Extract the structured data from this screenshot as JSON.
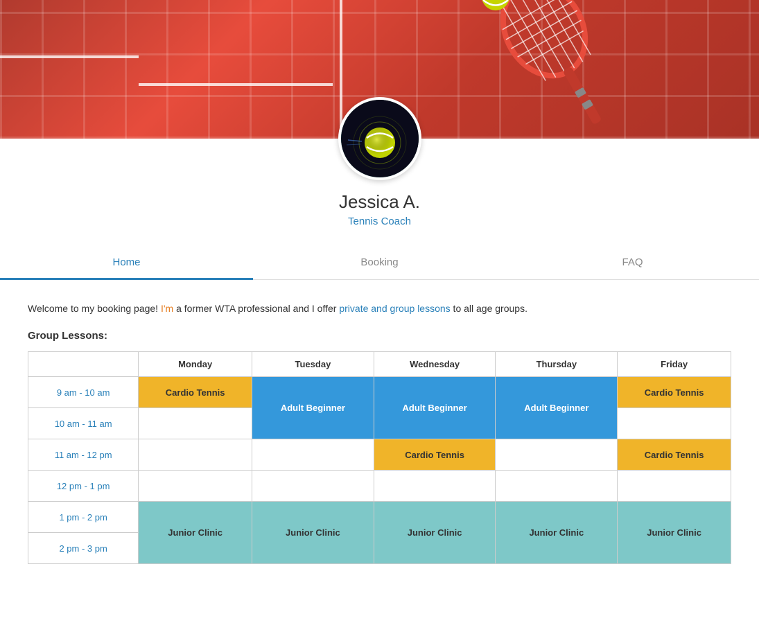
{
  "banner": {
    "alt": "Tennis court banner"
  },
  "profile": {
    "name": "Jessica A.",
    "role": "Tennis Coach",
    "avatar_alt": "Tennis ball profile picture"
  },
  "nav": {
    "tabs": [
      {
        "id": "home",
        "label": "Home",
        "active": true
      },
      {
        "id": "booking",
        "label": "Booking",
        "active": false
      },
      {
        "id": "faq",
        "label": "FAQ",
        "active": false
      }
    ]
  },
  "content": {
    "welcome_text_1": "Welcome to my booking page! ",
    "welcome_text_orange": "I'm",
    "welcome_text_2": " a former WTA professional and I offer ",
    "welcome_text_blue": "private and group lessons",
    "welcome_text_3": " to all age groups.",
    "group_lessons_label": "Group Lessons:"
  },
  "schedule": {
    "columns": [
      "",
      "Monday",
      "Tuesday",
      "Wednesday",
      "Thursday",
      "Friday"
    ],
    "rows": [
      {
        "time": "9 am - 10 am",
        "monday": {
          "label": "Cardio Tennis",
          "type": "yellow"
        },
        "tuesday": {
          "label": "Adult Beginner",
          "type": "blue",
          "rowspan": 2
        },
        "wednesday": {
          "label": "Adult Beginner",
          "type": "blue",
          "rowspan": 2
        },
        "thursday": {
          "label": "Adult Beginner",
          "type": "blue",
          "rowspan": 2
        },
        "friday": {
          "label": "Cardio Tennis",
          "type": "yellow"
        }
      },
      {
        "time": "10 am - 11 am",
        "monday": {
          "label": "",
          "type": "empty"
        },
        "tuesday": null,
        "wednesday": null,
        "thursday": null,
        "friday": {
          "label": "",
          "type": "empty"
        }
      },
      {
        "time": "11 am - 12 pm",
        "monday": {
          "label": "",
          "type": "empty"
        },
        "tuesday": {
          "label": "",
          "type": "empty"
        },
        "wednesday": {
          "label": "Cardio Tennis",
          "type": "yellow"
        },
        "thursday": {
          "label": "",
          "type": "empty"
        },
        "friday": {
          "label": "Cardio Tennis",
          "type": "yellow"
        }
      },
      {
        "time": "12 pm - 1 pm",
        "monday": {
          "label": "",
          "type": "empty"
        },
        "tuesday": {
          "label": "",
          "type": "empty"
        },
        "wednesday": {
          "label": "",
          "type": "empty"
        },
        "thursday": {
          "label": "",
          "type": "empty"
        },
        "friday": {
          "label": "",
          "type": "empty"
        }
      },
      {
        "time": "1 pm - 2 pm",
        "monday": {
          "label": "Junior Clinic",
          "type": "teal",
          "rowspan": 2
        },
        "tuesday": {
          "label": "Junior Clinic",
          "type": "teal",
          "rowspan": 2
        },
        "wednesday": {
          "label": "Junior Clinic",
          "type": "teal",
          "rowspan": 2
        },
        "thursday": {
          "label": "Junior Clinic",
          "type": "teal",
          "rowspan": 2
        },
        "friday": {
          "label": "Junior Clinic",
          "type": "teal",
          "rowspan": 2
        }
      },
      {
        "time": "2 pm - 3 pm",
        "monday": null,
        "tuesday": null,
        "wednesday": null,
        "thursday": null,
        "friday": null
      }
    ]
  }
}
